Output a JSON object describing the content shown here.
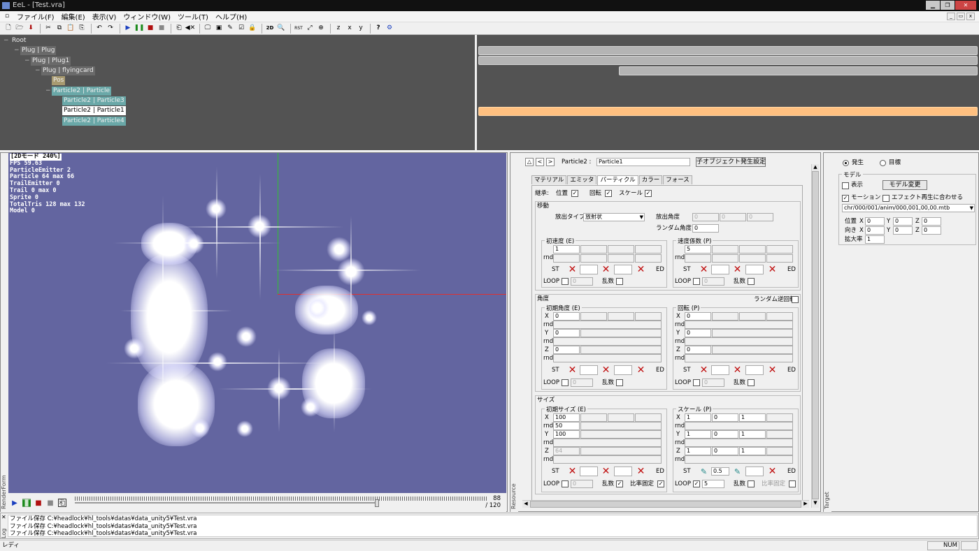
{
  "window": {
    "title": "EeL - [Test.vra]"
  },
  "menu": [
    "ファイル(F)",
    "編集(E)",
    "表示(V)",
    "ウィンドウ(W)",
    "ツール(T)",
    "ヘルプ(H)"
  ],
  "tree": {
    "root": "Root",
    "nodes": [
      {
        "label": "Plug | Plug"
      },
      {
        "label": "Plug | Plug1"
      },
      {
        "label": "Plug | flyingcard"
      },
      {
        "label": "Pos"
      },
      {
        "label": "Particle2 | Particle"
      },
      {
        "label": "Particle2 | Particle3"
      },
      {
        "label": "Particle2 | Particle1"
      },
      {
        "label": "Particle2 | Particle4"
      }
    ]
  },
  "render": {
    "panel_label": "RenderForm",
    "stats": [
      "[2Dモード 240%]",
      "FPS  59.63",
      "ParticleEmitter 2",
      "Particle 64  max 66",
      "TrailEmitter 0",
      "Trail 0  max 0",
      "Sprite 0",
      "TotalTris 128  max 132",
      "Model 0"
    ],
    "frame_current": "88",
    "frame_total": "/ 120",
    "progress": 0.733
  },
  "resource": {
    "panel_label": "Resource",
    "type_label": "Particle2 :",
    "name": "Particle1",
    "child_btn": "子オブジェクト発生設定",
    "tabs": [
      "マテリアル",
      "エミッタ",
      "パーティクル",
      "カラー",
      "フォース"
    ],
    "inherit": {
      "label": "継承:",
      "pos": "位置",
      "rot": "回転",
      "scale": "スケール"
    },
    "move": {
      "title": "移動",
      "emit_type_label": "放出タイプ",
      "emit_type": "放射状",
      "emit_angle_label": "放出角度",
      "emit_angle": [
        "0",
        "0",
        "0"
      ],
      "random_angle_label": "ランダム角度",
      "random_angle": "0",
      "init_speed": {
        "title": "初速度 (E)",
        "value": "1",
        "loop": "0"
      },
      "speed_coef": {
        "title": "速度係数 (P)",
        "value": "5",
        "loop": "0"
      }
    },
    "angle": {
      "title": "角度",
      "random_reverse": "ランダム逆回転",
      "init_angle": {
        "title": "初期角度 (E)",
        "x": "0",
        "y": "0",
        "z": "0",
        "loop": "0"
      },
      "rotation": {
        "title": "回転 (P)",
        "x": "0",
        "y": "0",
        "z": "0",
        "loop": "0"
      }
    },
    "size": {
      "title": "サイズ",
      "init_size": {
        "title": "初期サイズ (E)",
        "x": "100",
        "xrnd": "50",
        "y": "100",
        "z": "64",
        "loop": "0"
      },
      "scale": {
        "title": "スケール (P)",
        "x": [
          "1",
          "0",
          "1"
        ],
        "y": [
          "1",
          "0",
          "1"
        ],
        "z": [
          "1",
          "0",
          "1"
        ],
        "st_mid": "0.5",
        "loop": "5"
      }
    },
    "labels": {
      "rnd": "rnd",
      "st": "ST",
      "ed": "ED",
      "loop": "LOOP",
      "random": "乱数",
      "ratio_fix": "比率固定",
      "x": "X",
      "y": "Y",
      "z": "Z"
    }
  },
  "target": {
    "panel_label": "Target",
    "radio_emit": "発生",
    "radio_target": "目標",
    "model_group": "モデル",
    "show": "表示",
    "model_change": "モデル変更",
    "motion": "モーション",
    "sync_effect": "エフェクト再生に合わせる",
    "motion_path": "chr/000/001/anim/000,001,00,00.mtb",
    "pos_label": "位置",
    "dir_label": "向き",
    "scale_label": "拡大率",
    "pos": [
      "0",
      "0",
      "0"
    ],
    "dir": [
      "0",
      "0",
      "0"
    ],
    "scale": "1"
  },
  "log": {
    "panel_label": "Log",
    "lines": [
      "ファイル保存 C:¥headlock¥hl_tools¥datas¥data_unity5¥Test.vra",
      "ファイル保存 C:¥headlock¥hl_tools¥datas¥data_unity5¥Test.vra",
      "ファイル保存 C:¥headlock¥hl_tools¥datas¥data_unity5¥Test.vra"
    ]
  },
  "status": {
    "text": "レディ",
    "num": "NUM"
  },
  "colors": {
    "tree_bg": "#535353",
    "viewport_bg": "#6365a0",
    "highlight_orange": "#ffc080",
    "node_teal": "#6aa8a8"
  }
}
